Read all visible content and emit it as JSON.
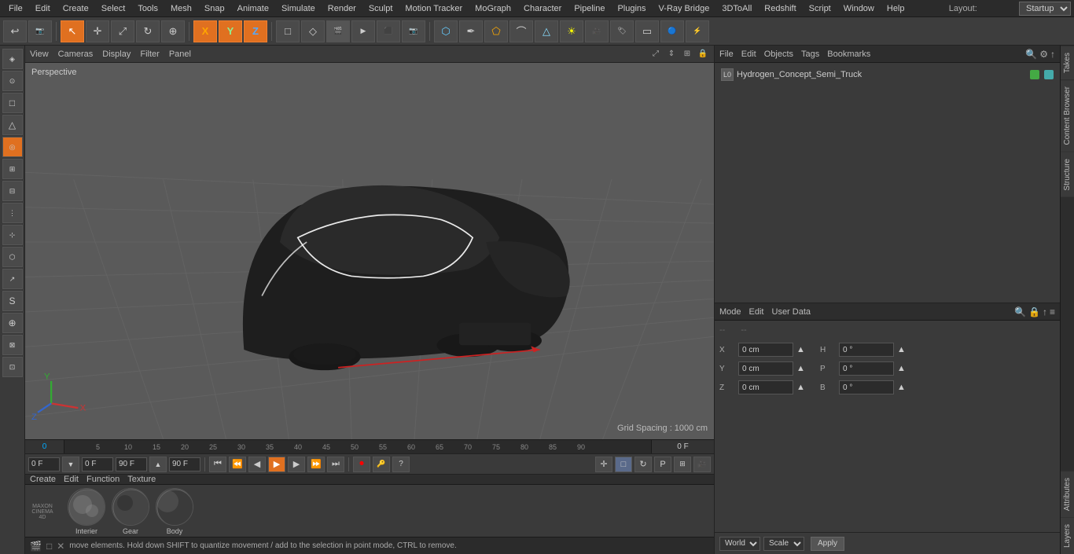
{
  "menubar": {
    "items": [
      "File",
      "Edit",
      "Create",
      "Select",
      "Tools",
      "Mesh",
      "Snap",
      "Animate",
      "Simulate",
      "Render",
      "Sculpt",
      "Motion Tracker",
      "MoGraph",
      "Character",
      "Pipeline",
      "Plugins",
      "V-Ray Bridge",
      "3DToAll",
      "Redshift",
      "Script",
      "Window",
      "Help"
    ],
    "layout_label": "Layout:",
    "layout_value": "Startup"
  },
  "toolbar": {
    "undo_icon": "↩",
    "move_icon": "↔",
    "scale_icon": "⤢",
    "rotate_icon": "↻",
    "position_icon": "⊕",
    "x_icon": "X",
    "y_icon": "Y",
    "z_icon": "Z",
    "object_icon": "□",
    "create_poly_icon": "◇",
    "anim_icon": "▶"
  },
  "viewport": {
    "header_items": [
      "View",
      "Cameras",
      "Display",
      "Filter",
      "Panel"
    ],
    "perspective_label": "Perspective",
    "grid_spacing": "Grid Spacing : 1000 cm"
  },
  "timeline": {
    "start": "0",
    "ticks": [
      "0",
      "5",
      "10",
      "15",
      "20",
      "25",
      "30",
      "35",
      "40",
      "45",
      "50",
      "55",
      "60",
      "65",
      "70",
      "75",
      "80",
      "85",
      "90"
    ],
    "end_field": "0 F",
    "current_label": "0 F"
  },
  "playback": {
    "field1": "0 F",
    "field2": "0 F",
    "field3": "90 F",
    "field4": "90 F"
  },
  "object_manager": {
    "header_items": [
      "File",
      "Edit",
      "Objects",
      "Tags",
      "Bookmarks"
    ],
    "objects": [
      {
        "name": "Hydrogen_Concept_Semi_Truck",
        "icon": "L0",
        "green": true,
        "teal": true
      }
    ]
  },
  "attributes": {
    "header_items": [
      "Mode",
      "Edit",
      "User Data"
    ],
    "rows": [
      {
        "x_label": "X",
        "x_val": "0 cm",
        "h_label": "H",
        "h_val": "0 °"
      },
      {
        "x_label": "Y",
        "x_val": "0 cm",
        "h_label": "P",
        "h_val": "0 °"
      },
      {
        "x_label": "Z",
        "x_val": "0 cm",
        "h_label": "B",
        "h_val": "0 °"
      }
    ]
  },
  "coord_bar": {
    "world_label": "World",
    "scale_label": "Scale",
    "apply_label": "Apply"
  },
  "status_bar": {
    "text": "move elements. Hold down SHIFT to quantize movement / add to the selection in point mode, CTRL to remove."
  },
  "materials": {
    "header_items": [
      "Create",
      "Edit",
      "Function",
      "Texture"
    ],
    "items": [
      {
        "name": "Interier"
      },
      {
        "name": "Gear"
      },
      {
        "name": "Body"
      }
    ]
  },
  "side_tabs": [
    "Takes",
    "Content Browser",
    "Structure"
  ],
  "attr_side_tabs": [
    "Attributes",
    "Layers"
  ],
  "left_sidebar_icons": [
    "◈",
    "✛",
    "⟳",
    "✥",
    "Ⓧ",
    "Ⓨ",
    "Ⓩ",
    "□",
    "◇",
    "⬠",
    "▽",
    "⏺",
    "⬡",
    "△",
    "⌒",
    "⎔",
    "⊙",
    "⌘",
    "↯",
    "⊕"
  ]
}
